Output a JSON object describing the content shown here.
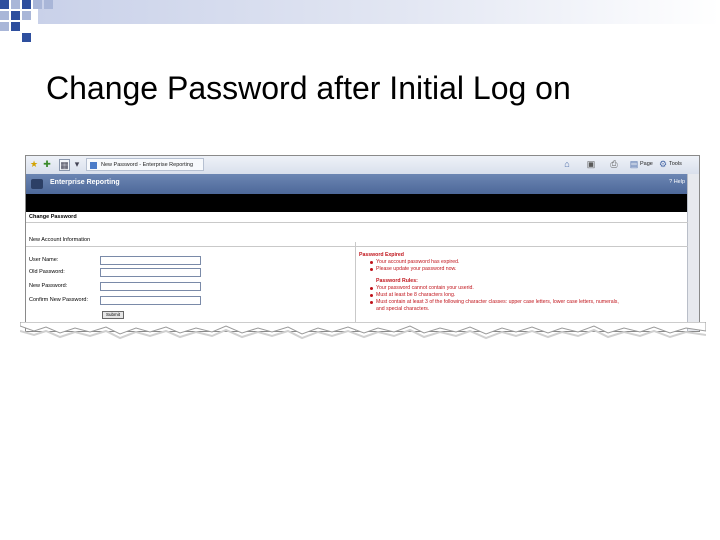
{
  "slide": {
    "title": "Change Password after Initial Log on"
  },
  "browser": {
    "tab_title": "New Password - Enterprise Reporting",
    "toolbar_items": [
      "Page",
      "Tools"
    ]
  },
  "app": {
    "title": "Enterprise Reporting",
    "help_label": "Help",
    "page_heading": "Change Password",
    "section_heading": "New Account Information"
  },
  "form": {
    "fields": [
      {
        "label": "User Name:",
        "value": ""
      },
      {
        "label": "Old Password:",
        "value": ""
      },
      {
        "label": "New Password:",
        "value": ""
      },
      {
        "label": "Confirm New Password:",
        "value": ""
      }
    ],
    "submit_label": "Submit"
  },
  "messages": {
    "expired_heading": "Password Expired",
    "expired_items": [
      "Your account password has expired.",
      "Please update your password now."
    ],
    "rules_heading": "Password Rules:",
    "rules_items": [
      "Your password cannot contain your userid.",
      "Must at least be 8 characters long.",
      "Must contain at least 3 of the following character classes: upper case letters, lower case letters, numerals,",
      "and special characters."
    ]
  },
  "colors": {
    "slide_accent": "#2e4f9e",
    "header_blue": "#5a75a6",
    "error_red": "#c0141b"
  }
}
